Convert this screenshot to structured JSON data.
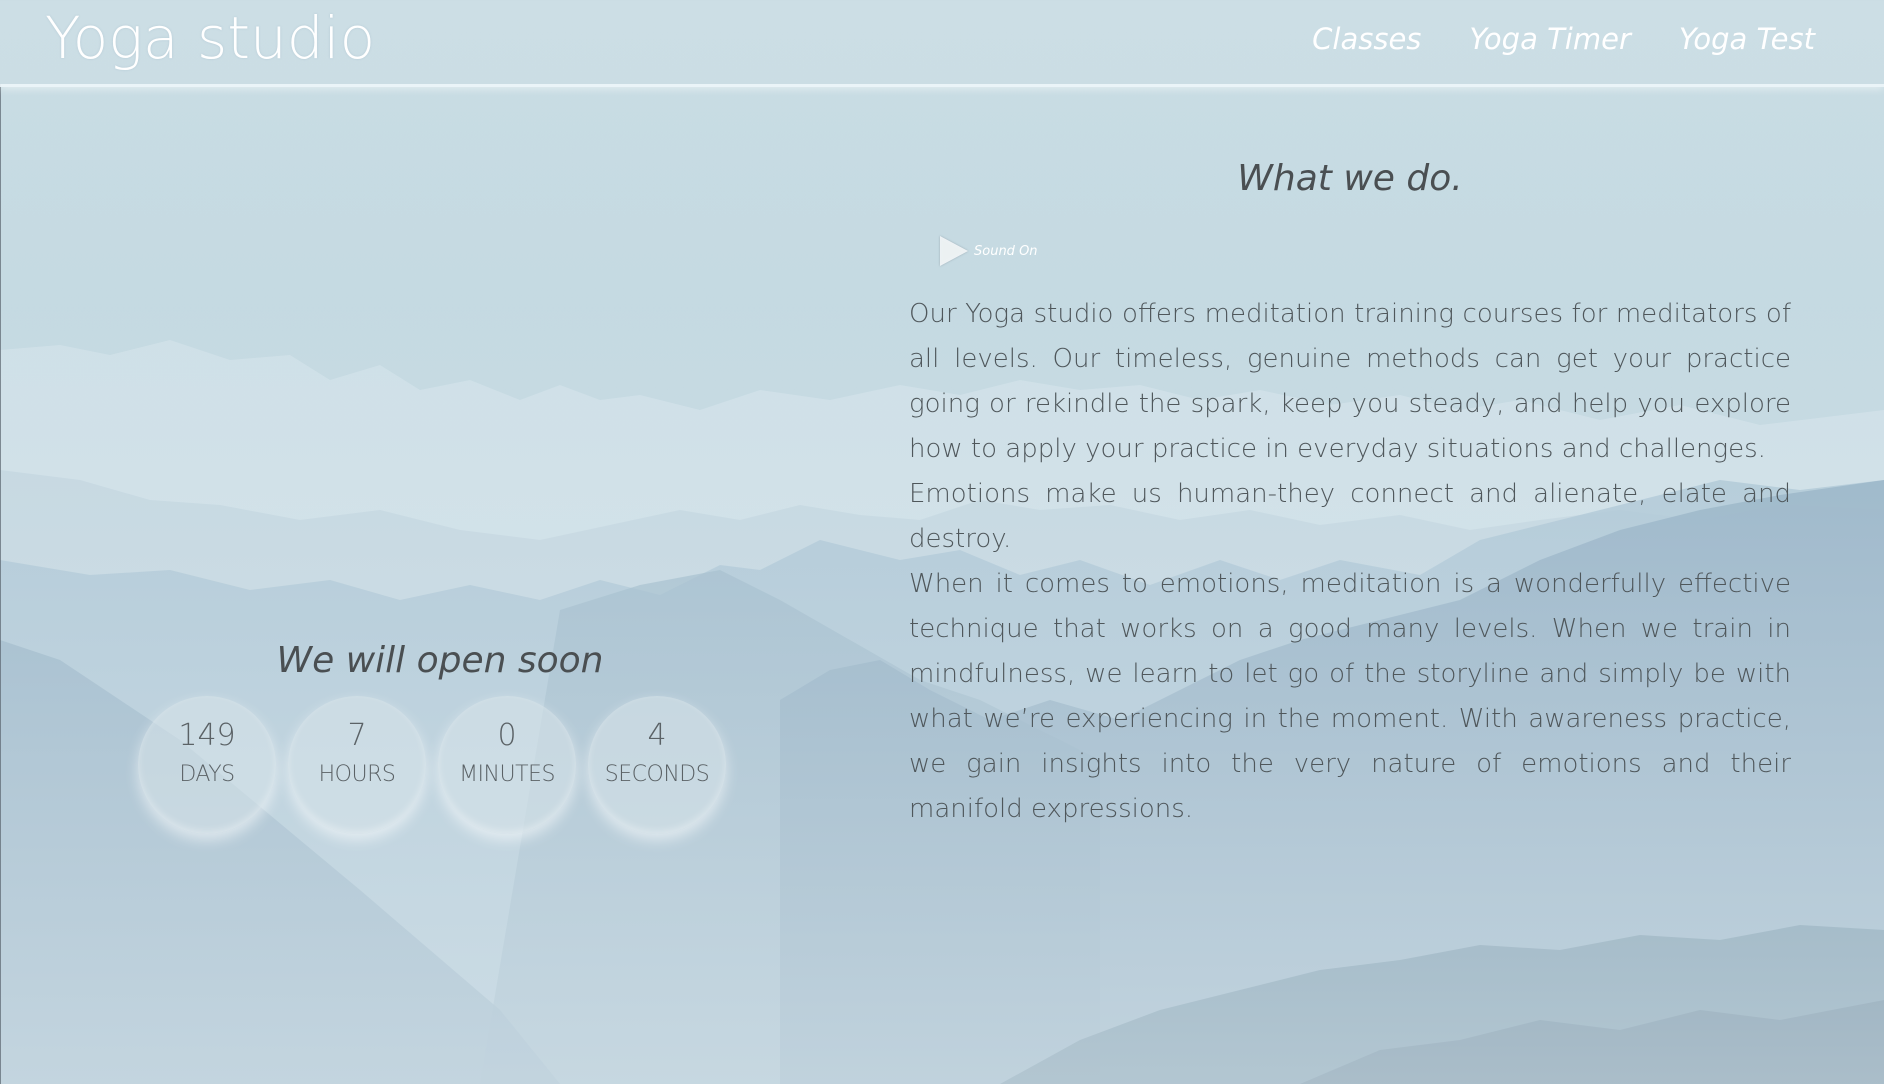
{
  "header": {
    "brand": "Yoga studio",
    "nav": [
      "Classes",
      "Yoga Timer",
      "Yoga Test"
    ]
  },
  "countdown": {
    "title": "We will open soon",
    "units": [
      {
        "value": "149",
        "label": "DAYS"
      },
      {
        "value": "7",
        "label": "HOURS"
      },
      {
        "value": "0",
        "label": "MINUTES"
      },
      {
        "value": "4",
        "label": "SECONDS"
      }
    ]
  },
  "about": {
    "title": "What we do.",
    "sound_label": "Sound On",
    "paragraphs": [
      "Our Yoga studio offers meditation training courses for meditators of all levels. Our timeless, genuine methods can get your practice going or rekindle the spark, keep you steady, and help you explore how to apply your practice in everyday situations and challenges.",
      "Emotions make us human-they connect and alienate, elate and destroy.",
      "When it comes to emotions, meditation is a wonderfully effective technique that works on a good many levels. When we train in mindfulness, we learn to let go of the storyline and simply be with what we’re experiencing in the moment. With awareness practice, we gain insights into the very nature of emotions and their manifold expressions."
    ]
  },
  "icons": {
    "play": "play-icon"
  },
  "colors": {
    "sky": "#c5dae2",
    "mountain_dark": "#7f9fb5",
    "text": "#4f575b",
    "nav_text": "#ffffff"
  }
}
